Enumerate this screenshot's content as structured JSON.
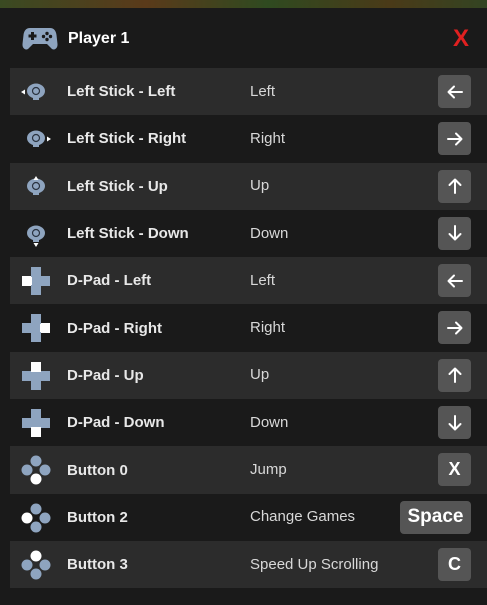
{
  "header": {
    "title": "Player 1",
    "close_label": "X",
    "icon": "gamepad-icon"
  },
  "colors": {
    "panel_bg": "#1a1a1a",
    "row_alt_bg": "#2c2c2c",
    "key_bg": "#555555",
    "close_red": "#e02020",
    "icon_blue_gray": "#8ea4bf"
  },
  "bindings": [
    {
      "input": "Left Stick - Left",
      "action": "Left",
      "key": "←",
      "icon": "stick-left-icon"
    },
    {
      "input": "Left Stick - Right",
      "action": "Right",
      "key": "→",
      "icon": "stick-right-icon"
    },
    {
      "input": "Left Stick - Up",
      "action": "Up",
      "key": "↑",
      "icon": "stick-up-icon"
    },
    {
      "input": "Left Stick - Down",
      "action": "Down",
      "key": "↓",
      "icon": "stick-down-icon"
    },
    {
      "input": "D-Pad - Left",
      "action": "Left",
      "key": "←",
      "icon": "dpad-left-icon"
    },
    {
      "input": "D-Pad - Right",
      "action": "Right",
      "key": "→",
      "icon": "dpad-right-icon"
    },
    {
      "input": "D-Pad - Up",
      "action": "Up",
      "key": "↑",
      "icon": "dpad-up-icon"
    },
    {
      "input": "D-Pad - Down",
      "action": "Down",
      "key": "↓",
      "icon": "dpad-down-icon"
    },
    {
      "input": "Button 0",
      "action": "Jump",
      "key": "X",
      "icon": "face-button-bottom-icon"
    },
    {
      "input": "Button 2",
      "action": "Change Games",
      "key": "Space",
      "icon": "face-button-left-icon"
    },
    {
      "input": "Button 3",
      "action": "Speed Up Scrolling",
      "key": "C",
      "icon": "face-button-top-icon"
    }
  ]
}
